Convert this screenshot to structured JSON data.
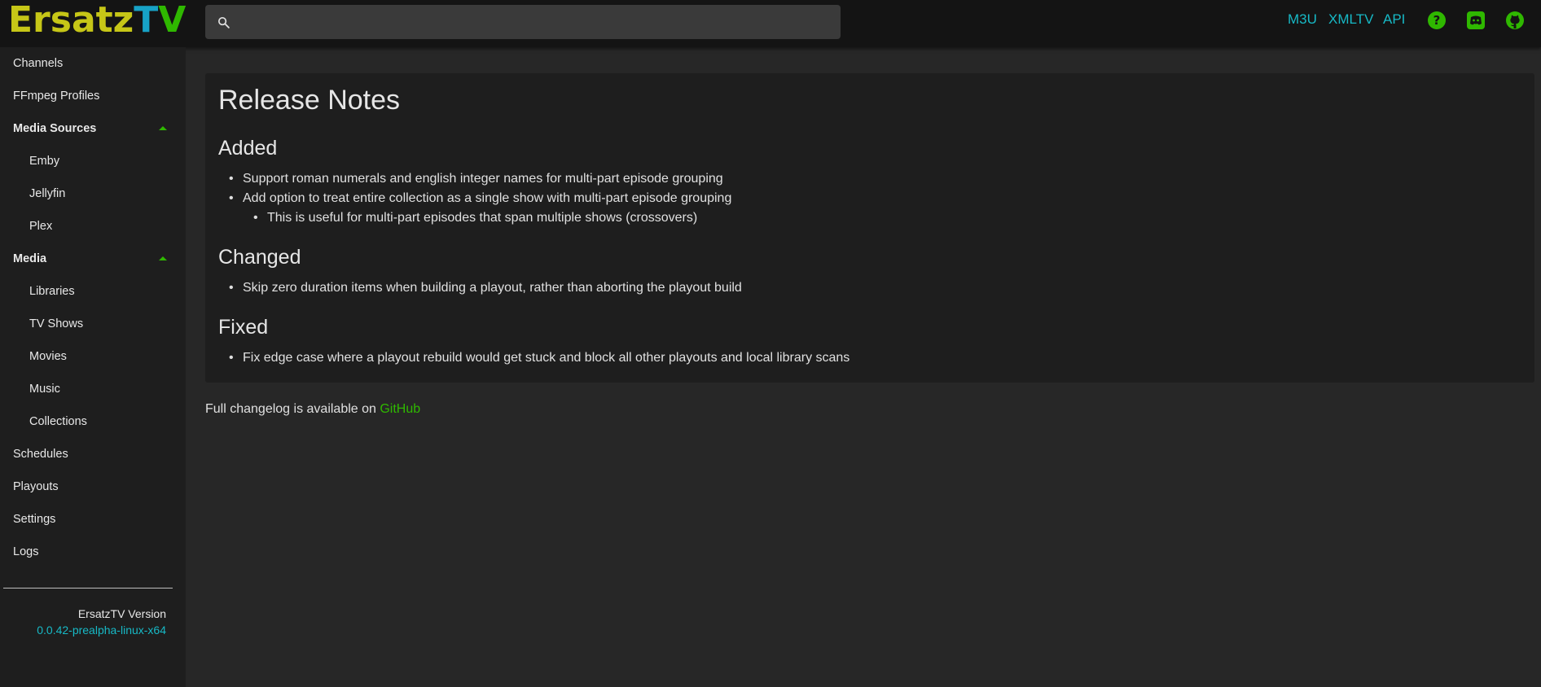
{
  "app": {
    "logo_part1": "Ersatz",
    "logo_part2": "T",
    "logo_part3": "V",
    "search_placeholder": "",
    "links": [
      "M3U",
      "XMLTV",
      "API"
    ],
    "icons": [
      "help-icon",
      "discord-icon",
      "github-icon"
    ],
    "colors": {
      "accent_green": "#2fb800",
      "accent_cyan": "#17b9c6",
      "logo_yellow": "#c6c617"
    }
  },
  "sidebar": {
    "channels": "Channels",
    "ffmpeg": "FFmpeg Profiles",
    "media_sources": "Media Sources",
    "emby": "Emby",
    "jellyfin": "Jellyfin",
    "plex": "Plex",
    "media": "Media",
    "libraries": "Libraries",
    "tv_shows": "TV Shows",
    "movies": "Movies",
    "music": "Music",
    "collections": "Collections",
    "schedules": "Schedules",
    "playouts": "Playouts",
    "settings": "Settings",
    "logs": "Logs",
    "version_label": "ErsatzTV Version",
    "version_value": "0.0.42-prealpha-linux-x64"
  },
  "release_notes": {
    "title": "Release Notes",
    "added_heading": "Added",
    "added_1": "Support roman numerals and english integer names for multi-part episode grouping",
    "added_2": "Add option to treat entire collection as a single show with multi-part episode grouping",
    "added_2_sub": "This is useful for multi-part episodes that span multiple shows (crossovers)",
    "changed_heading": "Changed",
    "changed_1": "Skip zero duration items when building a playout, rather than aborting the playout build",
    "fixed_heading": "Fixed",
    "fixed_1": "Fix edge case where a playout rebuild would get stuck and block all other playouts and local library scans"
  },
  "footer": {
    "text": "Full changelog is available on ",
    "link": "GitHub"
  }
}
